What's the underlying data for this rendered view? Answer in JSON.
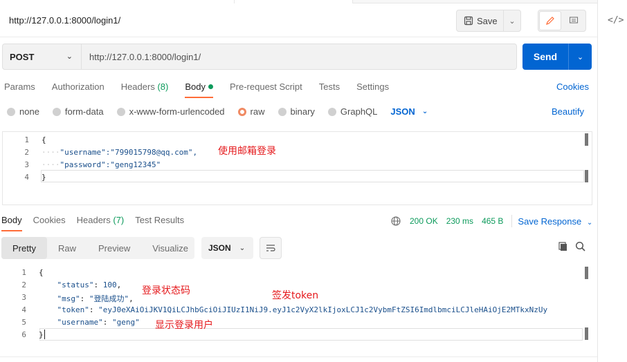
{
  "header": {
    "title": "http://127.0.0.1:8000/login1/",
    "save_label": "Save"
  },
  "request": {
    "method": "POST",
    "url": "http://127.0.0.1:8000/login1/",
    "send_label": "Send"
  },
  "request_tabs": [
    {
      "label": "Params"
    },
    {
      "label": "Authorization"
    },
    {
      "label": "Headers",
      "count": "(8)"
    },
    {
      "label": "Body"
    },
    {
      "label": "Pre-request Script"
    },
    {
      "label": "Tests"
    },
    {
      "label": "Settings"
    }
  ],
  "cookies_label": "Cookies",
  "body_types": [
    "none",
    "form-data",
    "x-www-form-urlencoded",
    "raw",
    "binary",
    "GraphQL"
  ],
  "body_format": "JSON",
  "beautify_label": "Beautify",
  "request_body": {
    "line_numbers": [
      "1",
      "2",
      "3",
      "4"
    ],
    "lines": [
      "{",
      "\"username\":\"799015798@qq.com\",",
      "\"password\":\"geng12345\"",
      "}"
    ],
    "annotation": "使用邮箱登录"
  },
  "response_tabs": [
    {
      "label": "Body"
    },
    {
      "label": "Cookies"
    },
    {
      "label": "Headers",
      "count": "(7)"
    },
    {
      "label": "Test Results"
    }
  ],
  "response_meta": {
    "status": "200 OK",
    "time": "230 ms",
    "size": "465 B",
    "save_response": "Save Response"
  },
  "view_modes": [
    "Pretty",
    "Raw",
    "Preview",
    "Visualize"
  ],
  "response_format": "JSON",
  "response_body": {
    "line_numbers": [
      "1",
      "2",
      "3",
      "4",
      "5",
      "6"
    ],
    "status_key": "\"status\"",
    "status_val": "100",
    "msg_key": "\"msg\"",
    "msg_val": "\"登陆成功\"",
    "token_key": "\"token\"",
    "token_val": "\"eyJ0eXAiOiJKV1QiLCJhbGciOiJIUzI1NiJ9.eyJ1c2VyX2lkIjoxLCJ1c2VybmFtZSI6ImdlbmciLCJleHAiOjE2MTkxNzUy",
    "username_key": "\"username\"",
    "username_val": "\"geng\"",
    "annotations": {
      "status": "登录状态码",
      "token": "签发token",
      "username": "显示登录用户"
    }
  },
  "colors": {
    "accent": "#ff6c37",
    "primary": "#0265d2",
    "success": "#0c9a5b",
    "annotation": "#e5191c"
  }
}
